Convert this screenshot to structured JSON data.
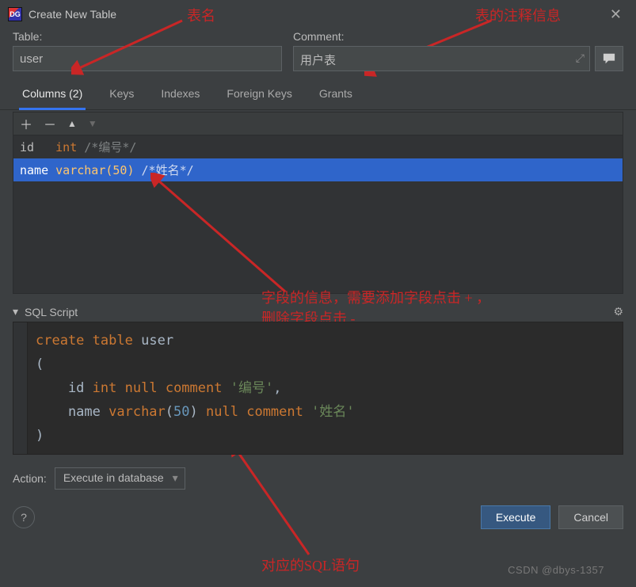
{
  "window": {
    "title": "Create New Table"
  },
  "icons": {
    "app_text": "DG"
  },
  "annotations": {
    "table_name": "表名",
    "comment_info": "表的注释信息",
    "fields_info_line1": "字段的信息，需要添加字段点击 + ，",
    "fields_info_line2": "删除字段点击 -",
    "sql_label": "对应的SQL语句"
  },
  "fields": {
    "table_label": "Table:",
    "table_value": "user",
    "comment_label": "Comment:",
    "comment_value": "用户表"
  },
  "tabs": [
    {
      "label": "Columns (2)",
      "active": true
    },
    {
      "label": "Keys",
      "active": false
    },
    {
      "label": "Indexes",
      "active": false
    },
    {
      "label": "Foreign Keys",
      "active": false
    },
    {
      "label": "Grants",
      "active": false
    }
  ],
  "columns": [
    {
      "name": "id",
      "type": "int",
      "comment": "/*编号*/",
      "selected": false
    },
    {
      "name": "name",
      "type": "varchar(50)",
      "comment": "/*姓名*/",
      "selected": true
    }
  ],
  "script": {
    "header": "SQL Script",
    "tokens": [
      [
        {
          "t": "create",
          "c": "k-orange"
        },
        {
          "t": " ",
          "c": ""
        },
        {
          "t": "table",
          "c": "k-orange"
        },
        {
          "t": " ",
          "c": ""
        },
        {
          "t": "user",
          "c": "k-id"
        }
      ],
      [
        {
          "t": "(",
          "c": "k-punc"
        }
      ],
      [
        {
          "t": "    id ",
          "c": "k-id"
        },
        {
          "t": "int",
          "c": "k-orange"
        },
        {
          "t": " ",
          "c": ""
        },
        {
          "t": "null",
          "c": "k-orange"
        },
        {
          "t": " ",
          "c": ""
        },
        {
          "t": "comment",
          "c": "k-orange"
        },
        {
          "t": " ",
          "c": ""
        },
        {
          "t": "'编号'",
          "c": "k-str"
        },
        {
          "t": ",",
          "c": "k-punc"
        }
      ],
      [
        {
          "t": "    name ",
          "c": "k-id"
        },
        {
          "t": "varchar",
          "c": "k-orange"
        },
        {
          "t": "(",
          "c": "k-punc"
        },
        {
          "t": "50",
          "c": "k-num"
        },
        {
          "t": ")",
          "c": "k-punc"
        },
        {
          "t": " ",
          "c": ""
        },
        {
          "t": "null",
          "c": "k-orange"
        },
        {
          "t": " ",
          "c": ""
        },
        {
          "t": "comment",
          "c": "k-orange"
        },
        {
          "t": " ",
          "c": ""
        },
        {
          "t": "'姓名'",
          "c": "k-str"
        }
      ],
      [
        {
          "t": ")",
          "c": "k-punc"
        }
      ]
    ]
  },
  "action": {
    "label": "Action:",
    "value": "Execute in database"
  },
  "buttons": {
    "execute": "Execute",
    "cancel": "Cancel",
    "help": "?"
  },
  "watermark": "CSDN @dbys-1357"
}
